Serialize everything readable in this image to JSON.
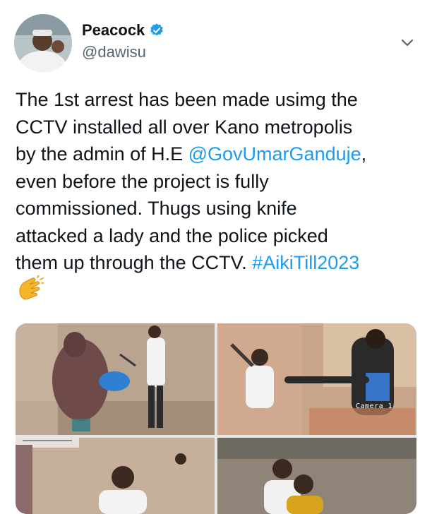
{
  "tweet": {
    "author": {
      "display_name": "Peacock",
      "handle": "@dawisu",
      "verified": true
    },
    "text_lines": [
      [
        {
          "t": "The 1st arrest has been made usimg the"
        }
      ],
      [
        {
          "t": "CCTV installed all over Kano metropolis"
        }
      ],
      [
        {
          "t": "by the admin of H.E "
        },
        {
          "t": "@GovUmarGanduje",
          "link": true
        },
        {
          "t": ","
        }
      ],
      [
        {
          "t": "even before the project is fully"
        }
      ],
      [
        {
          "t": "commissioned. Thugs using knife"
        }
      ],
      [
        {
          "t": "attacked a lady and the police picked"
        }
      ],
      [
        {
          "t": "them up through the CCTV. "
        },
        {
          "t": "#AikiTill2023",
          "link": true
        }
      ]
    ],
    "emoji": "clapping-hands",
    "media": {
      "count": 4,
      "camera_label": "Camera 1"
    }
  },
  "icons": {
    "verified": "verified-badge-icon",
    "menu": "chevron-down-icon"
  },
  "colors": {
    "link": "#1d9bf0",
    "verified": "#1d9bf0",
    "secondary_text": "#536471"
  }
}
